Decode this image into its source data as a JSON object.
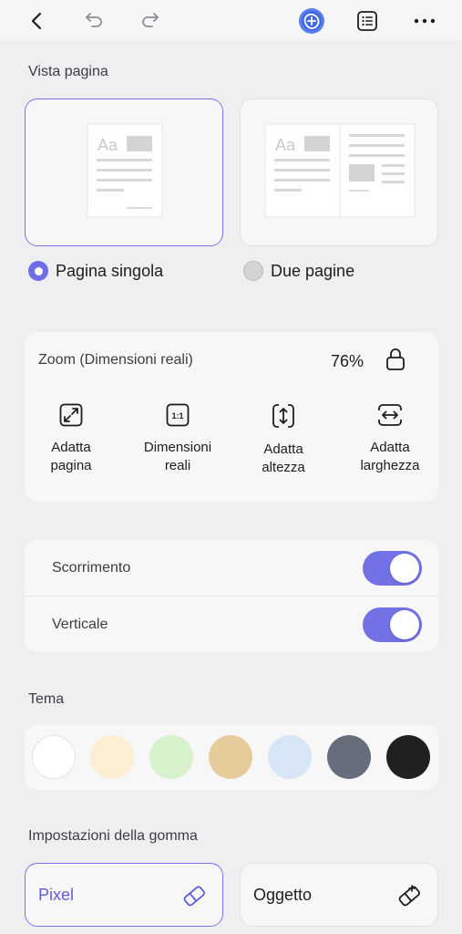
{
  "toolbar": {
    "back_icon": "chevron-left-icon",
    "undo_icon": "undo-icon",
    "redo_icon": "redo-icon",
    "ai_icon": "ai-assistant-icon",
    "list_icon": "list-icon",
    "more_icon": "more-icon"
  },
  "page_view": {
    "title": "Vista pagina",
    "thumb_text": "Aa",
    "options": [
      {
        "label": "Pagina singola",
        "selected": true
      },
      {
        "label": "Due pagine",
        "selected": false
      }
    ]
  },
  "zoom": {
    "title": "Zoom (Dimensioni reali)",
    "value": "76%",
    "actual_size_glyph": "1:1",
    "options": [
      {
        "label": "Adatta\npagina",
        "icon": "fit-page-icon"
      },
      {
        "label": "Dimensioni\nreali",
        "icon": "actual-size-icon"
      },
      {
        "label": "Adatta\naltezza",
        "icon": "fit-height-icon"
      },
      {
        "label": "Adatta\nlarghezza",
        "icon": "fit-width-icon"
      }
    ]
  },
  "toggles": [
    {
      "label": "Scorrimento",
      "on": true
    },
    {
      "label": "Verticale",
      "on": true
    }
  ],
  "theme": {
    "title": "Tema",
    "colors": [
      "#ffffff",
      "#fbeed3",
      "#d6f1cb",
      "#e6cc9b",
      "#d6e6f6",
      "#666d7b",
      "#202021"
    ]
  },
  "eraser": {
    "title": "Impostazioni della gomma",
    "options": [
      {
        "label": "Pixel",
        "selected": true,
        "icon": "eraser-icon"
      },
      {
        "label": "Oggetto",
        "selected": false,
        "icon": "object-eraser-icon"
      }
    ]
  },
  "colors": {
    "accent": "#7272e6",
    "accent_text": "#5f5de0"
  }
}
